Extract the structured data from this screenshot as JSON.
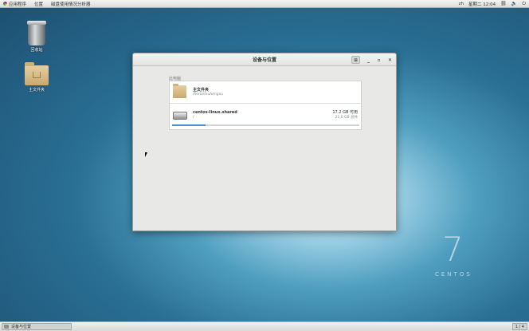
{
  "topbar": {
    "applications": "应用程序",
    "places": "位置",
    "current_app": "磁盘使用情况分析器",
    "input_method": "zh",
    "datetime": "星期二 12:04"
  },
  "desktop": {
    "trash_label": "回收站",
    "home_label": "主文件夹"
  },
  "window": {
    "title": "设备与位置",
    "section_label": "此电脑",
    "devices": [
      {
        "name": "主文件夹",
        "path": "/home/xuhengxu"
      },
      {
        "name": "centos-linux.shared",
        "path": "/",
        "free": "17.2 GB 可用",
        "total": "21.0 GB 总共",
        "usage_fraction": 0.18
      }
    ]
  },
  "taskbar": {
    "task_label": "设备与位置",
    "workspace": "1 / 4"
  },
  "branding": {
    "version": "7",
    "name": "CENTOS"
  }
}
